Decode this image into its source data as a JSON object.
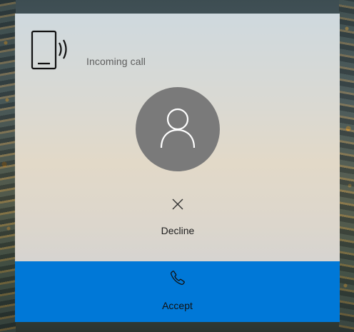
{
  "notification": {
    "status_text": "Incoming call",
    "phone_icon": "phone-ringing-icon",
    "avatar_icon": "person-icon"
  },
  "actions": {
    "decline_label": "Decline",
    "decline_icon": "close-icon",
    "accept_label": "Accept",
    "accept_icon": "phone-handset-icon"
  },
  "colors": {
    "accent": "#0078d7",
    "avatar_bg": "#7a7a7a",
    "panel_bg": "#d9d9d3"
  }
}
